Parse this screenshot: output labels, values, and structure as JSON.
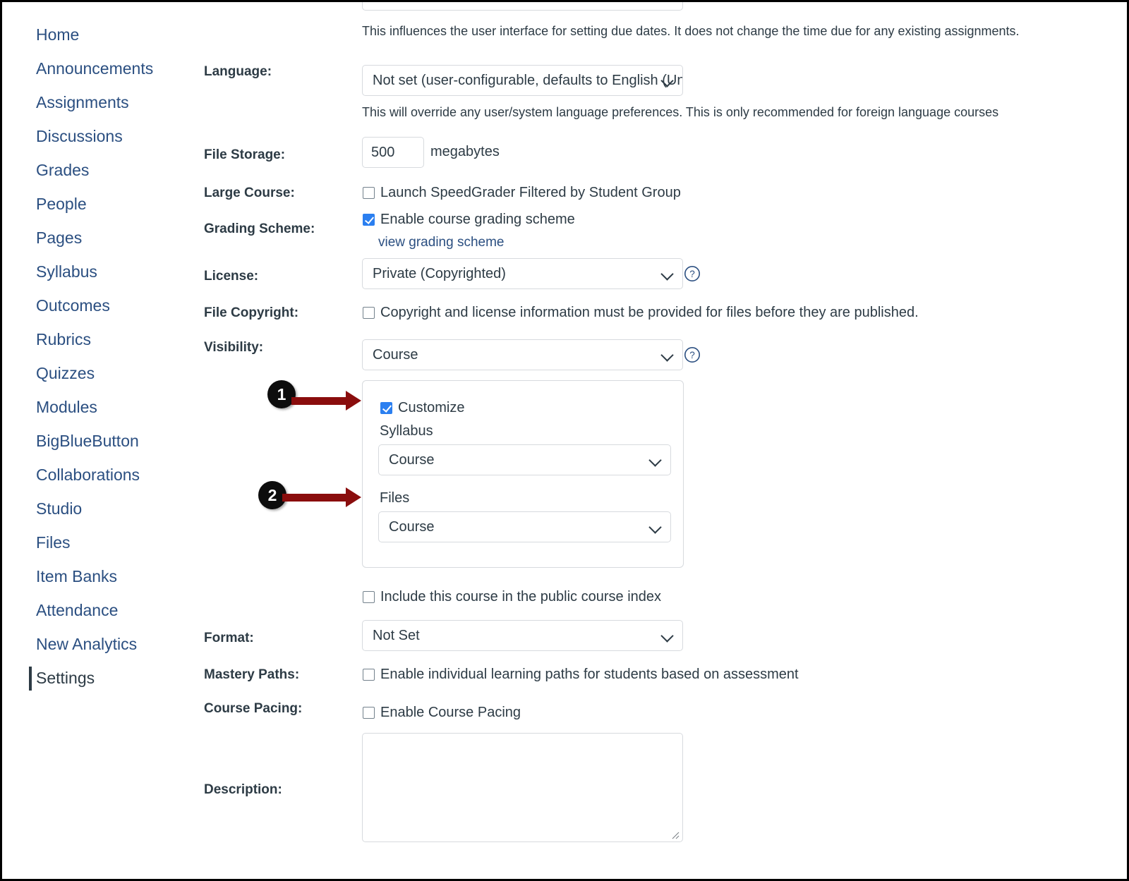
{
  "sidebar": {
    "items": [
      {
        "label": "Home",
        "active": false
      },
      {
        "label": "Announcements",
        "active": false
      },
      {
        "label": "Assignments",
        "active": false
      },
      {
        "label": "Discussions",
        "active": false
      },
      {
        "label": "Grades",
        "active": false
      },
      {
        "label": "People",
        "active": false
      },
      {
        "label": "Pages",
        "active": false
      },
      {
        "label": "Syllabus",
        "active": false
      },
      {
        "label": "Outcomes",
        "active": false
      },
      {
        "label": "Rubrics",
        "active": false
      },
      {
        "label": "Quizzes",
        "active": false
      },
      {
        "label": "Modules",
        "active": false
      },
      {
        "label": "BigBlueButton",
        "active": false
      },
      {
        "label": "Collaborations",
        "active": false
      },
      {
        "label": "Studio",
        "active": false
      },
      {
        "label": "Files",
        "active": false
      },
      {
        "label": "Item Banks",
        "active": false
      },
      {
        "label": "Attendance",
        "active": false
      },
      {
        "label": "New Analytics",
        "active": false
      },
      {
        "label": "Settings",
        "active": true
      }
    ]
  },
  "form": {
    "time_zone_help": "This influences the user interface for setting due dates. It does not change the time due for any existing assignments.",
    "language": {
      "label": "Language:",
      "value": "Not set (user-configurable, defaults to English (Uni",
      "help": "This will override any user/system language preferences. This is only recommended for foreign language courses"
    },
    "file_storage": {
      "label": "File Storage:",
      "value": "500",
      "unit": "megabytes"
    },
    "large_course": {
      "label": "Large Course:",
      "checkbox_label": "Launch SpeedGrader Filtered by Student Group",
      "checked": false
    },
    "grading_scheme": {
      "label": "Grading Scheme:",
      "checkbox_label": "Enable course grading scheme",
      "checked": true,
      "link_label": "view grading scheme"
    },
    "license": {
      "label": "License:",
      "value": "Private (Copyrighted)",
      "help_icon": "question-circle-icon"
    },
    "file_copyright": {
      "label": "File Copyright:",
      "checkbox_label": "Copyright and license information must be provided for files before they are published.",
      "checked": false
    },
    "visibility": {
      "label": "Visibility:",
      "value": "Course",
      "help_icon": "question-circle-icon"
    },
    "customize_panel": {
      "checkbox_label": "Customize",
      "checked": true,
      "syllabus_label": "Syllabus",
      "syllabus_value": "Course",
      "files_label": "Files",
      "files_value": "Course"
    },
    "public_index": {
      "checkbox_label": "Include this course in the public course index",
      "checked": false
    },
    "format": {
      "label": "Format:",
      "value": "Not Set"
    },
    "mastery_paths": {
      "label": "Mastery Paths:",
      "checkbox_label": "Enable individual learning paths for students based on assessment",
      "checked": false
    },
    "course_pacing": {
      "label": "Course Pacing:",
      "checkbox_label": "Enable Course Pacing",
      "checked": false
    },
    "description": {
      "label": "Description:",
      "value": ""
    }
  },
  "annotations": [
    {
      "number": "1",
      "target": "customize-checkbox"
    },
    {
      "number": "2",
      "target": "files-select"
    }
  ],
  "colors": {
    "link": "#2b4f81",
    "checkbox_accent": "#2b7ff0",
    "annotation_badge": "#0d0d0d",
    "annotation_arrow": "#8a0d0d",
    "border": "#d7dade",
    "text": "#2d3b45"
  }
}
